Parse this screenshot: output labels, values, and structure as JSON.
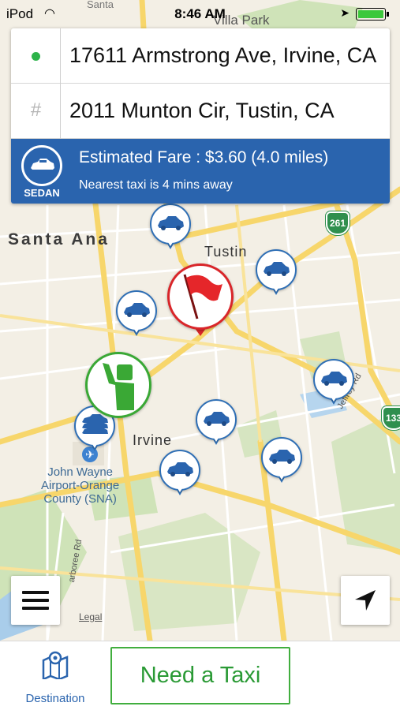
{
  "status_bar": {
    "carrier": "iPod",
    "time": "8:46 AM"
  },
  "route": {
    "pickup": "17611 Armstrong Ave, Irvine, CA",
    "destination": "2011 Munton Cir, Tustin, CA"
  },
  "fare_panel": {
    "vehicle_type": "SEDAN",
    "fare_text": "Estimated Fare : $3.60 (4.0 miles)",
    "nearest_text": "Nearest taxi is 4 mins away",
    "color": "#2a64ae"
  },
  "map": {
    "labels": {
      "santa_ana": "Santa Ana",
      "tustin": "Tustin",
      "irvine": "Irvine",
      "villa_park": "Villa Park",
      "santa_top": "Santa",
      "airport": "John Wayne\nAirport-Orange\nCounty (SNA)",
      "jeffrey_rd": "Jeffrey Rd",
      "harbor_rd": "arboree Rd",
      "legal": "Legal",
      "hwy_261": "261",
      "hwy_133": "133"
    },
    "taxi_count": 9,
    "pin_colors": {
      "taxi": "#2f6fb5",
      "destination": "#d9262a",
      "user": "#3aa835"
    }
  },
  "controls": {
    "menu_icon": "hamburger-icon",
    "locate_icon": "location-arrow-icon"
  },
  "bottom_bar": {
    "destination_label": "Destination",
    "destination_icon": "map-icon",
    "need_taxi_label": "Need a Taxi",
    "accent": "#41ae3e"
  }
}
